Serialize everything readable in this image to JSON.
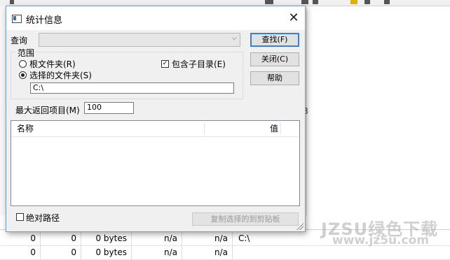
{
  "dialog": {
    "title": "统计信息",
    "close_glyph": "✕",
    "query_label": "查询",
    "query_value": "",
    "buttons": {
      "find": "查找(F)",
      "close": "关闭(C)",
      "help": "帮助",
      "copy": "复制选择的到剪贴板"
    },
    "scope": {
      "label": "范围",
      "root_option": "根文件夹(R)",
      "selected_option": "选择的文件夹(S)",
      "include_subdirs": "包含子目录(E)",
      "include_subdirs_checked": true,
      "selected": "selected_option",
      "path_value": "C:\\"
    },
    "max_items": {
      "label": "最大返回项目(M)",
      "value": "100"
    },
    "results": {
      "columns": [
        "名称",
        "值"
      ]
    },
    "absolute_path": {
      "label": "绝对路径",
      "checked": false
    }
  },
  "background_grid": {
    "rows": [
      [
        "0",
        "0",
        "0 bytes",
        "n/a",
        "n/a",
        "C:\\"
      ],
      [
        "0",
        "0",
        "0 bytes",
        "n/a",
        "n/a",
        ""
      ]
    ]
  },
  "watermark": {
    "line1": "JZSU绿色下载",
    "line2": "www.jz5u.com"
  },
  "colors": {
    "dialog_border": "#7a9bc4",
    "primary_button_border": "#3c7fd8",
    "dialog_background": "#f0f0f0"
  }
}
